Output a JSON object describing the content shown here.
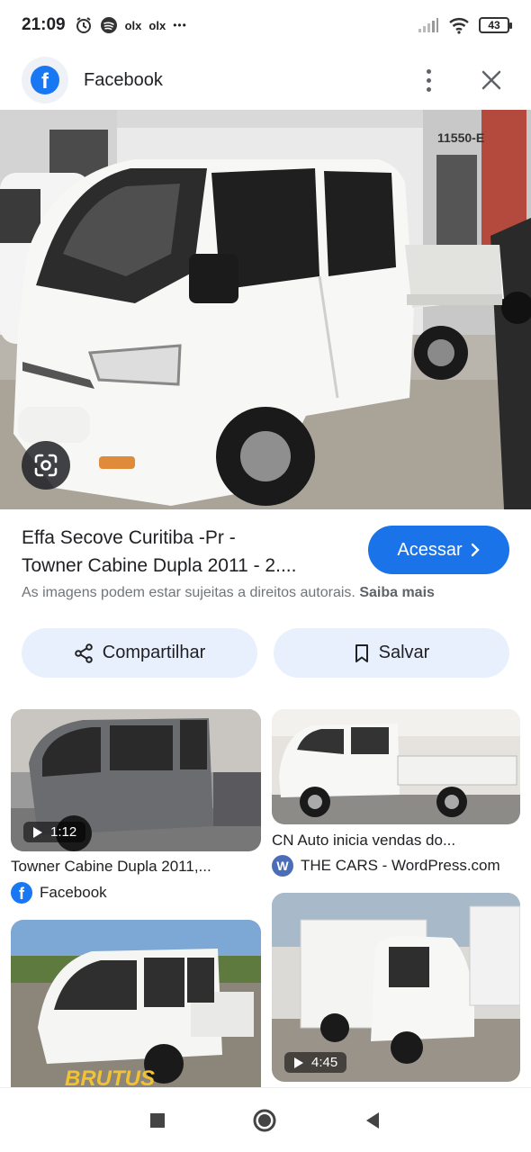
{
  "status": {
    "time": "21:09",
    "notif_icons": [
      "alarm-icon",
      "spotify-icon",
      "olx",
      "olx",
      "more-dots"
    ],
    "olx1": "olx",
    "olx2": "olx",
    "dots": "•••",
    "battery": "43"
  },
  "header": {
    "title": "Facebook",
    "logo_letter": "f"
  },
  "result": {
    "title_line1": "Effa Secove Curitiba -Pr -",
    "title_line2": "Towner Cabine Dupla 2011 - 2....",
    "access_label": "Acessar",
    "rights_text": "As imagens podem estar sujeitas a direitos autorais.",
    "learn_more": "Saiba mais",
    "lot_sign": "11550-E"
  },
  "actions": {
    "share_label": "Compartilhar",
    "save_label": "Salvar"
  },
  "related": [
    {
      "caption": "Towner Cabine Dupla 2011,...",
      "source": "Facebook",
      "duration": "1:12"
    },
    {
      "caption": "CN Auto inicia vendas do...",
      "source": "THE CARS - WordPress.com",
      "duration": ""
    },
    {
      "caption": "",
      "source": "",
      "duration": "",
      "overlay_text": "BRUTUS"
    },
    {
      "caption": "",
      "source": "",
      "duration": "4:45"
    }
  ],
  "colors": {
    "accent": "#1a73e8",
    "facebook_blue": "#1877f2",
    "pill_bg": "#e8f0fe"
  }
}
